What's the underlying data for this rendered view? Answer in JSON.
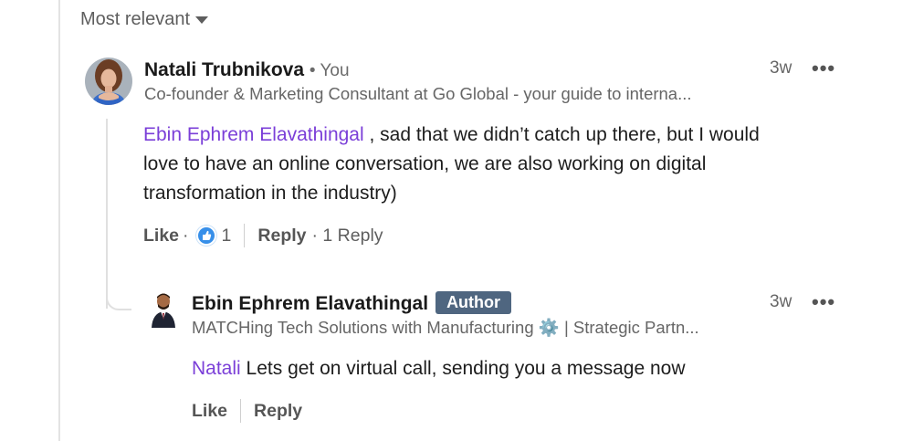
{
  "sort": {
    "label": "Most relevant"
  },
  "comment": {
    "author": "Natali Trubnikova",
    "author_meta": "• You",
    "headline": "Co-founder & Marketing Consultant at Go Global - your guide to interna...",
    "time": "3w",
    "more": "•••",
    "mention": "Ebin Ephrem Elavathingal",
    "text_line1": " , sad that we didn’t catch up there, but I would",
    "text_line2": "love to have an online conversation, we are also working on digital",
    "text_line3": "transformation in the industry)",
    "like_label": "Like",
    "dot": "·",
    "reaction_count": "1",
    "reply_label": "Reply",
    "reply_count": "· 1 Reply"
  },
  "reply": {
    "author": "Ebin Ephrem Elavathingal",
    "badge": "Author",
    "headline": "MATCHing Tech Solutions with Manufacturing ⚙️ | Strategic Partn...",
    "time": "3w",
    "more": "•••",
    "mention": "Natali",
    "text": " Lets get on virtual call, sending you a message now",
    "like_label": "Like",
    "reply_label": "Reply"
  },
  "colors": {
    "mention": "#7b3fd8",
    "badge": "#4f6680",
    "reaction": "#378fe9"
  }
}
